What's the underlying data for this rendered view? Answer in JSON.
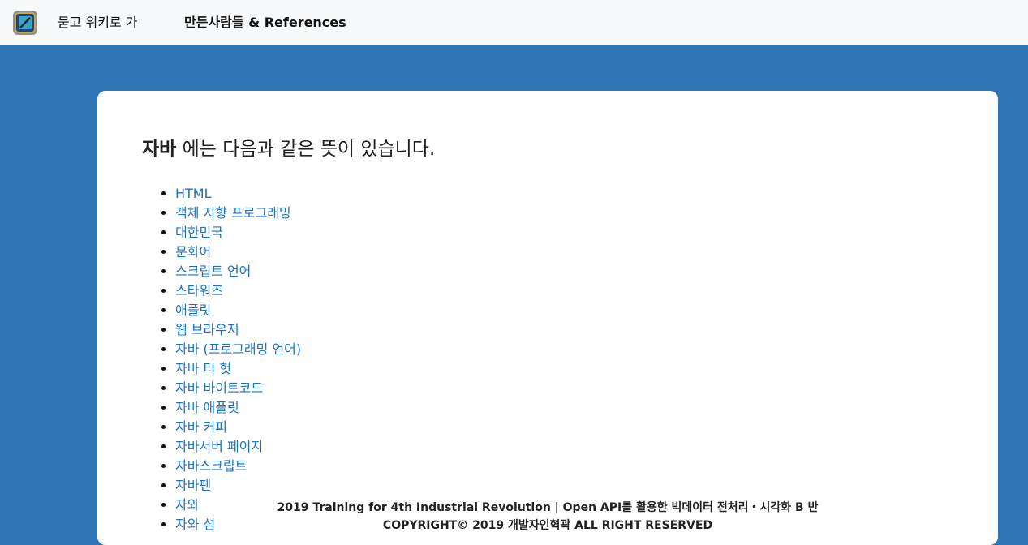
{
  "navbar": {
    "logo_icon": "site-logo-icon",
    "home_link": "묻고 위키로 가",
    "references_link": "만든사람들 & References"
  },
  "main": {
    "query": "자바",
    "heading_suffix": "에는 다음과 같은 뜻이 있습니다.",
    "results": [
      "HTML",
      "객체 지향 프로그래밍",
      "대한민국",
      "문화어",
      "스크립트 언어",
      "스타워즈",
      "애플릿",
      "웹 브라우저",
      "자바 (프로그래밍 언어)",
      "자바 더 헛",
      "자바 바이트코드",
      "자바 애플릿",
      "자바 커피",
      "자바서버 페이지",
      "자바스크립트",
      "자바펜",
      "자와",
      "자와 섬"
    ]
  },
  "footer": {
    "line1": "2019 Training for 4th Industrial Revolution | Open API를 활용한 빅데이터 전처리・시각화 B 반",
    "line2": "COPYRIGHT© 2019 개발자인혁곽 ALL RIGHT RESERVED"
  },
  "colors": {
    "background": "#2e75b6",
    "navbar": "#f8f9fa",
    "link": "#1a73c4"
  }
}
